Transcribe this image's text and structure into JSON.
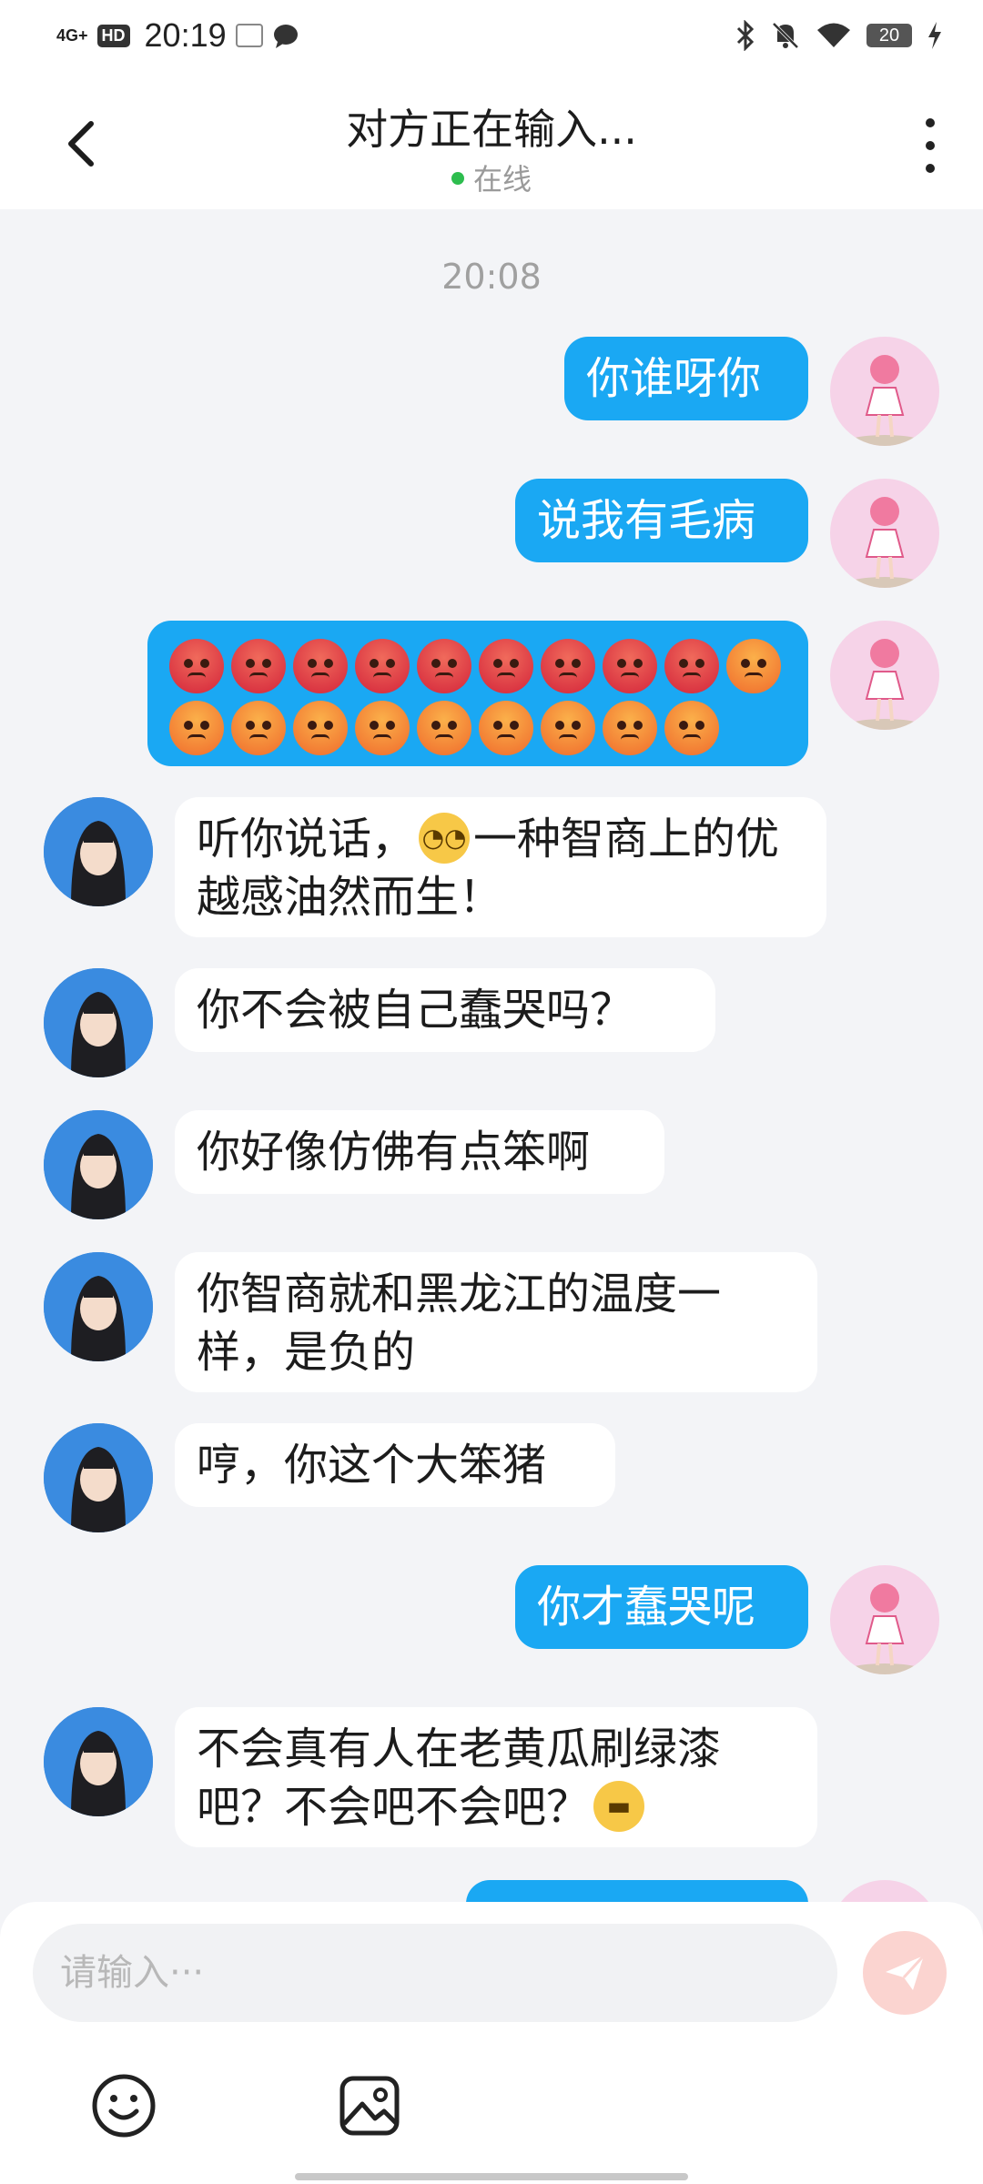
{
  "status_bar": {
    "network": "4G+",
    "hd": "HD",
    "time": "20:19",
    "battery": "20"
  },
  "header": {
    "title": "对方正在输入...",
    "status": "在线"
  },
  "chat": {
    "timestamp": "20:08",
    "messages": [
      {
        "side": "me",
        "text": "你谁呀你"
      },
      {
        "side": "me",
        "text": "说我有毛病"
      },
      {
        "side": "me",
        "emoji_row": "angry",
        "count": 19
      },
      {
        "side": "them",
        "text_before": "听你说话，",
        "emoji": "eye-roll",
        "text_after": "一种智商上的优越感油然而生！"
      },
      {
        "side": "them",
        "text": "你不会被自己蠢哭吗？"
      },
      {
        "side": "them",
        "text": "你好像仿佛有点笨啊"
      },
      {
        "side": "them",
        "text": "你智商就和黑龙江的温度一样，是负的"
      },
      {
        "side": "them",
        "text": "哼，你这个大笨猪"
      },
      {
        "side": "me",
        "text": "你才蠢哭呢"
      },
      {
        "side": "them",
        "text": "不会真有人在老黄瓜刷绿漆吧？不会吧不会吧？",
        "emoji": "grin"
      }
    ]
  },
  "input": {
    "placeholder": "请输入···"
  },
  "colors": {
    "my_bubble": "#1aa8f3",
    "their_bubble": "#ffffff",
    "online_dot": "#2dbd4e",
    "send_button": "#fbd4d0"
  }
}
